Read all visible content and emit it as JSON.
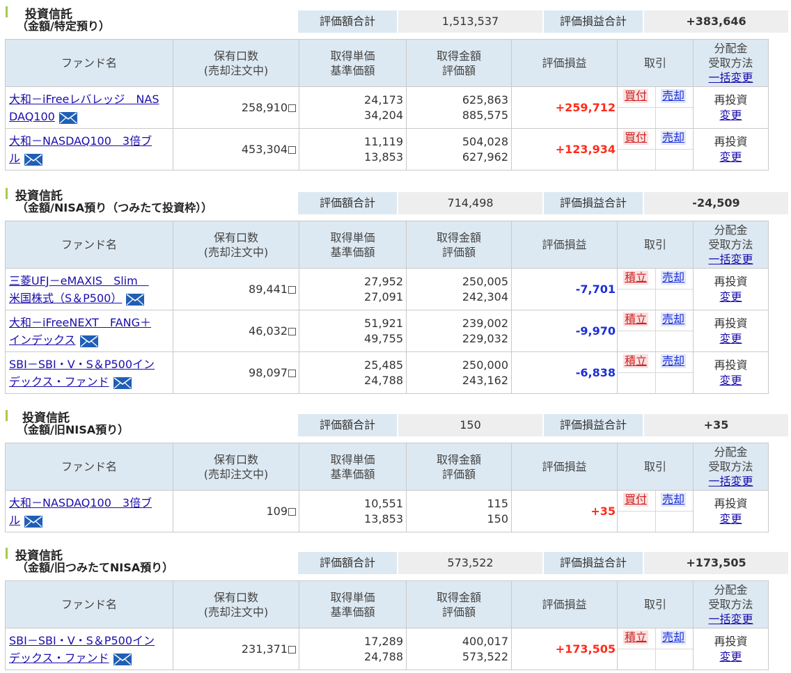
{
  "columns": {
    "fund_name": "ファンド名",
    "units_1": "保有口数",
    "units_2": "(売却注文中)",
    "cost_1": "取得単価",
    "cost_2": "基準価額",
    "amount_1": "取得金額",
    "amount_2": "評価額",
    "gain": "評価損益",
    "trade": "取引",
    "dist_1": "分配金",
    "dist_2": "受取方法",
    "dist_link": "一括変更"
  },
  "summary_labels": {
    "value": "評価額合計",
    "gain": "評価損益合計"
  },
  "reinvest": {
    "label": "再投資",
    "change": "変更"
  },
  "sell_label": "売却",
  "colors": {
    "positive": "#ff2a1a",
    "negative": "#1a2fd6",
    "header_bg": "#dde9f2",
    "accent": "#a7c94e"
  },
  "sections": [
    {
      "title1": "投資信託",
      "title2": "（金額/特定預り）",
      "total_value": "1,513,537",
      "total_gain": "+383,646",
      "funds": [
        {
          "name_1": "大和－iFreeレバレッジ　NAS",
          "name_2": "DAQ100",
          "units": "258,910",
          "cost": "24,173",
          "nav": "34,204",
          "cost_amount": "625,863",
          "value": "885,575",
          "gain": "+259,712",
          "buy": "買付"
        },
        {
          "name_1": "大和－NASDAQ100　3倍ブ",
          "name_2": "ル",
          "units": "453,304",
          "cost": "11,119",
          "nav": "13,853",
          "cost_amount": "504,028",
          "value": "627,962",
          "gain": "+123,934",
          "buy": "買付"
        }
      ]
    },
    {
      "title1": "投資信託",
      "title2": "（金額/NISA預り（つみたて投資枠））",
      "total_value": "714,498",
      "total_gain": "-24,509",
      "funds": [
        {
          "name_1": "三菱UFJ－eMAXIS　Slim　",
          "name_2": "米国株式（S＆P500）",
          "units": "89,441",
          "cost": "27,952",
          "nav": "27,091",
          "cost_amount": "250,005",
          "value": "242,304",
          "gain": "-7,701",
          "buy": "積立"
        },
        {
          "name_1": "大和－iFreeNEXT　FANG＋",
          "name_2": "インデックス",
          "units": "46,032",
          "cost": "51,921",
          "nav": "49,755",
          "cost_amount": "239,002",
          "value": "229,032",
          "gain": "-9,970",
          "buy": "積立"
        },
        {
          "name_1": "SBI－SBI・V・S＆P500イン",
          "name_2": "デックス・ファンド",
          "units": "98,097",
          "cost": "25,485",
          "nav": "24,788",
          "cost_amount": "250,000",
          "value": "243,162",
          "gain": "-6,838",
          "buy": "積立"
        }
      ]
    },
    {
      "title1": "投資信託",
      "title2": "（金額/旧NISA預り）",
      "total_value": "150",
      "total_gain": "+35",
      "funds": [
        {
          "name_1": "大和－NASDAQ100　3倍ブ",
          "name_2": "ル",
          "units": "109",
          "cost": "10,551",
          "nav": "13,853",
          "cost_amount": "115",
          "value": "150",
          "gain": "+35",
          "buy": "買付"
        }
      ]
    },
    {
      "title1": "投資信託",
      "title2": "（金額/旧つみたてNISA預り）",
      "total_value": "573,522",
      "total_gain": "+173,505",
      "funds": [
        {
          "name_1": "SBI－SBI・V・S＆P500イン",
          "name_2": "デックス・ファンド",
          "units": "231,371",
          "cost": "17,289",
          "nav": "24,788",
          "cost_amount": "400,017",
          "value": "573,522",
          "gain": "+173,505",
          "buy": "積立"
        }
      ]
    }
  ]
}
